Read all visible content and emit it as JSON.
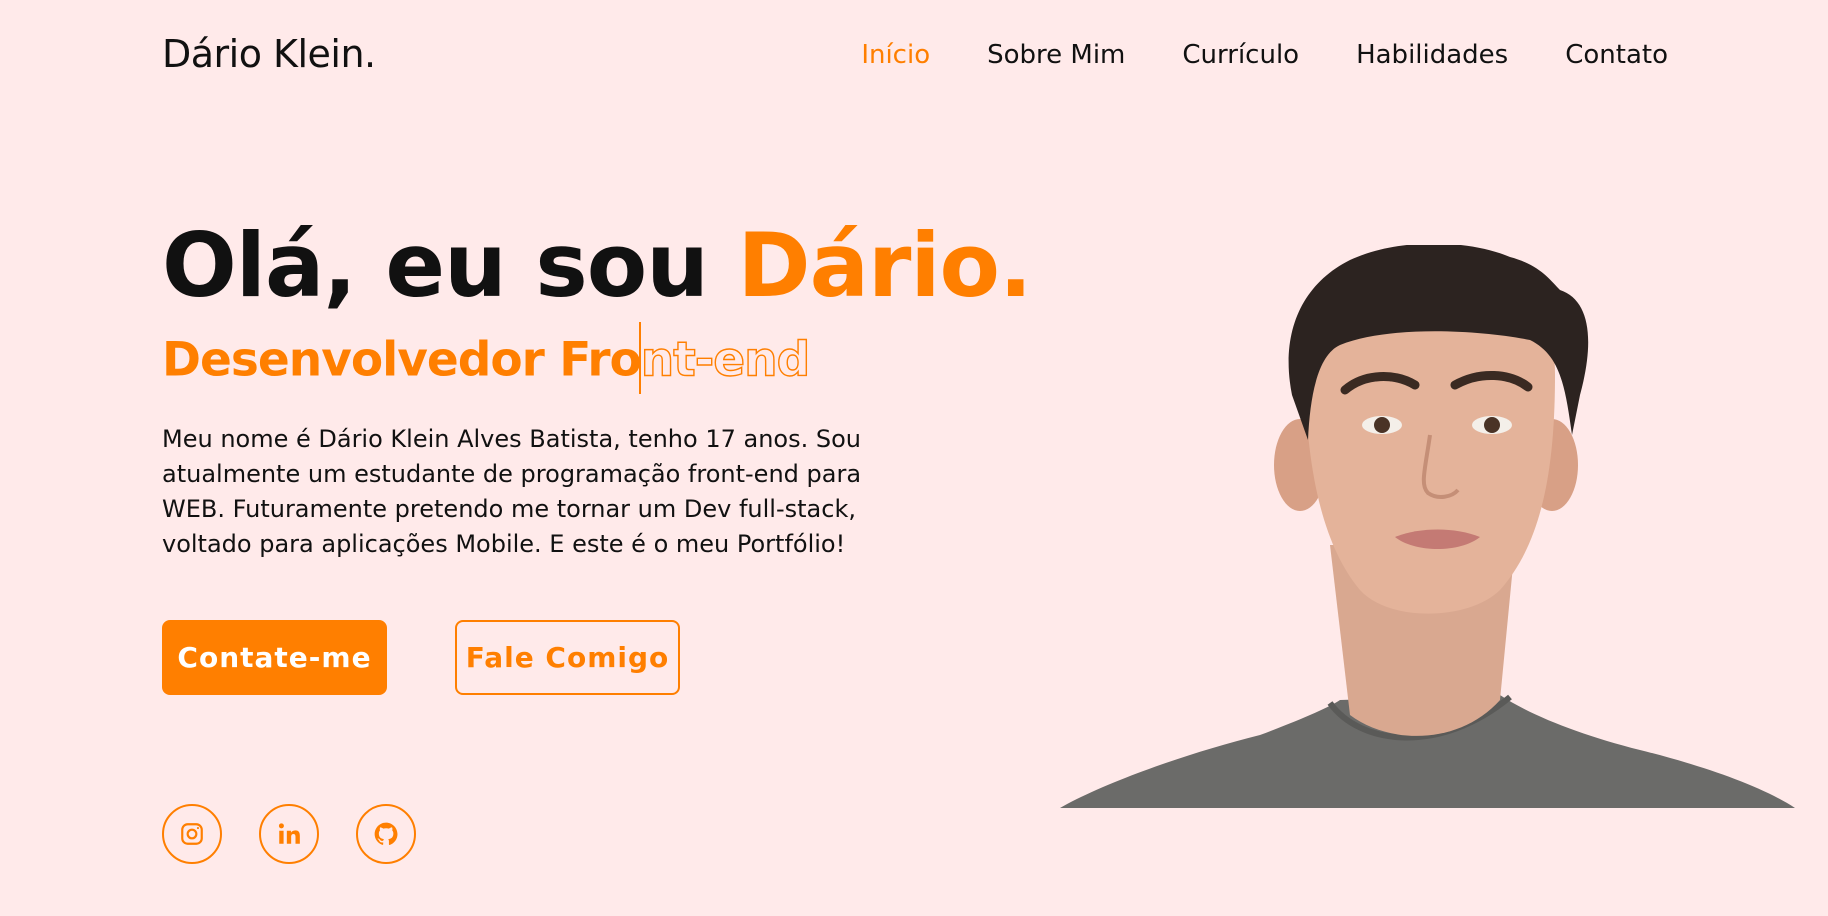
{
  "header": {
    "logo": "Dário Klein.",
    "nav": [
      {
        "label": "Início",
        "active": true
      },
      {
        "label": "Sobre Mim"
      },
      {
        "label": "Currículo"
      },
      {
        "label": "Habilidades"
      },
      {
        "label": "Contato"
      }
    ]
  },
  "hero": {
    "title_prefix": "Olá, eu sou ",
    "title_name": "Dário.",
    "subtitle_typed": "Desenvolvedor Fro",
    "subtitle_remaining": "nt-end",
    "description": "Meu nome é Dário Klein Alves Batista, tenho 17 anos. Sou atualmente um estudante de programação front-end para WEB. Futuramente pretendo me tornar um Dev full-stack, voltado para aplicações Mobile. E este é o meu Portfólio!",
    "primary_button": "Contate-me",
    "secondary_button": "Fale Comigo"
  },
  "socials": [
    {
      "icon": "instagram-icon"
    },
    {
      "icon": "linkedin-icon"
    },
    {
      "icon": "github-icon"
    }
  ],
  "colors": {
    "accent": "#ff7f00",
    "background": "#ffeaea",
    "text": "#111111"
  }
}
